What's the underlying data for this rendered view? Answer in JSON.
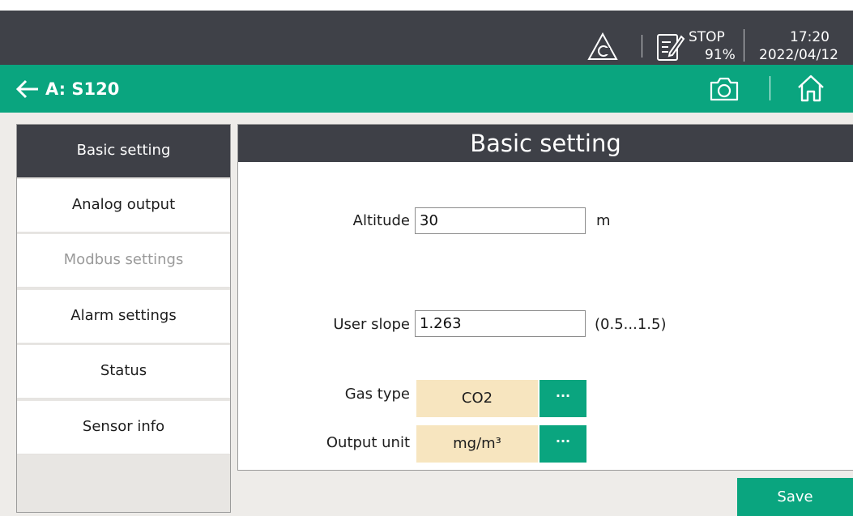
{
  "status_bar": {
    "run_state": "STOP",
    "memory_pct": "91%",
    "time": "17:20",
    "date": "2022/04/12",
    "icons": [
      "warning-c-icon",
      "document-edit-icon"
    ]
  },
  "app_bar": {
    "title": "A: S120",
    "icons": [
      "back-arrow-icon",
      "camera-icon",
      "home-icon"
    ]
  },
  "sidebar": {
    "items": [
      {
        "label": "Basic setting",
        "state": "active"
      },
      {
        "label": "Analog output",
        "state": "normal"
      },
      {
        "label": "Modbus settings",
        "state": "disabled"
      },
      {
        "label": "Alarm settings",
        "state": "normal"
      },
      {
        "label": "Status",
        "state": "normal"
      },
      {
        "label": "Sensor info",
        "state": "normal"
      }
    ]
  },
  "panel": {
    "title": "Basic setting",
    "altitude": {
      "label": "Altitude",
      "value": "30",
      "unit": "m"
    },
    "user_slope": {
      "label": "User slope",
      "value": "1.263",
      "range": "(0.5...1.5)"
    },
    "gas_type": {
      "label": "Gas type",
      "value": "CO2",
      "more": "···"
    },
    "output_unit": {
      "label": "Output unit",
      "value": "mg/m³",
      "more": "···"
    }
  },
  "save_label": "Save",
  "colors": {
    "accent": "#0aa57f",
    "dark": "#3e4047",
    "select_bg": "#f7e5bf",
    "background": "#eeece9"
  }
}
